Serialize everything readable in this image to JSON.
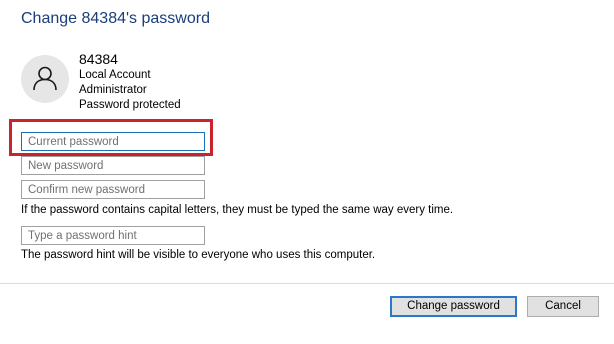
{
  "dialog": {
    "title": "Change 84384's password"
  },
  "account": {
    "avatar_icon": "user-icon",
    "name": "84384",
    "type": "Local Account",
    "role": "Administrator",
    "status": "Password protected"
  },
  "fields": {
    "current_password": {
      "placeholder": "Current password",
      "value": ""
    },
    "new_password": {
      "placeholder": "New password",
      "value": ""
    },
    "confirm_password": {
      "placeholder": "Confirm new password",
      "value": ""
    },
    "hint": {
      "placeholder": "Type a password hint",
      "value": ""
    }
  },
  "notes": {
    "capital_letters": "If the password contains capital letters, they must be typed the same way every time.",
    "hint_visibility": "The password hint will be visible to everyone who uses this computer."
  },
  "buttons": {
    "change_password": "Change password",
    "cancel": "Cancel"
  },
  "colors": {
    "title": "#1a3e7a",
    "highlight": "#c8242c",
    "focus_border": "#1f6fb5",
    "primary_button_border": "#2a78c6"
  }
}
